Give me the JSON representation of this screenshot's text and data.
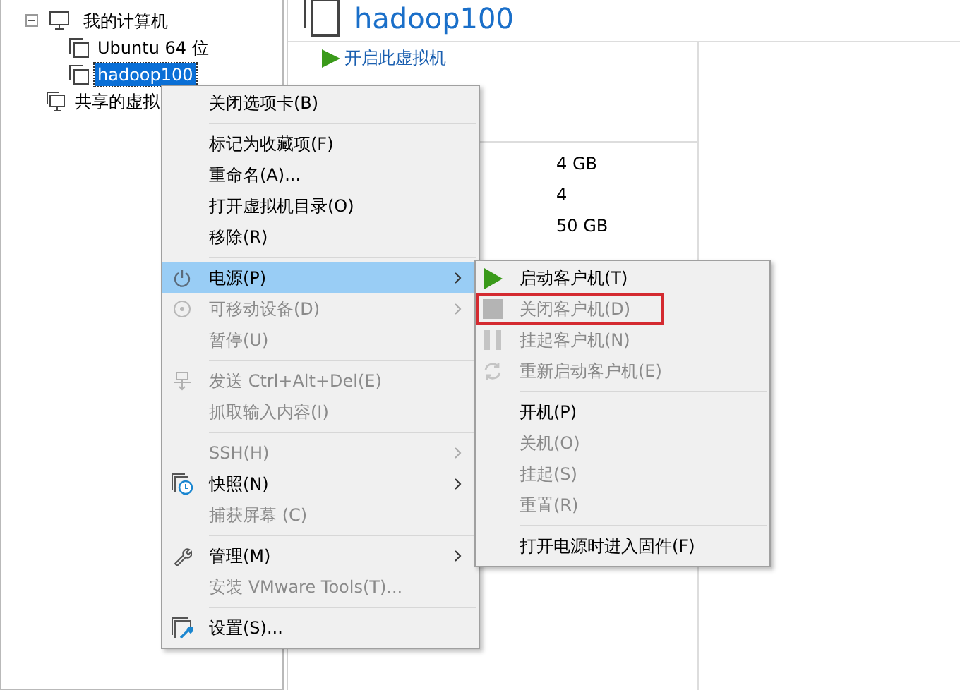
{
  "tree": [
    {
      "label": "我的计算机",
      "kind": "computer",
      "expanded": true,
      "selected": false,
      "children": [
        {
          "label": "Ubuntu 64 位",
          "kind": "vm",
          "selected": false
        },
        {
          "label": "hadoop100",
          "kind": "vm",
          "selected": true
        }
      ]
    },
    {
      "label": "共享的虚拟",
      "kind": "shared",
      "selected": false
    }
  ],
  "summary": {
    "title": "hadoop100",
    "action": "开启此虚拟机",
    "values": [
      "4 GB",
      "4",
      "50 GB"
    ]
  },
  "menu": {
    "items": [
      {
        "kind": "item",
        "label": "关闭选项卡(B)",
        "disabled": false,
        "submenu": false,
        "selected": false
      },
      {
        "kind": "separator"
      },
      {
        "kind": "item",
        "label": "标记为收藏项(F)",
        "disabled": false,
        "submenu": false,
        "selected": false
      },
      {
        "kind": "item",
        "label": "重命名(A)...",
        "disabled": false,
        "submenu": false,
        "selected": false
      },
      {
        "kind": "item",
        "label": "打开虚拟机目录(O)",
        "disabled": false,
        "submenu": false,
        "selected": false
      },
      {
        "kind": "item",
        "label": "移除(R)",
        "disabled": false,
        "submenu": false,
        "selected": false
      },
      {
        "kind": "separator"
      },
      {
        "kind": "item",
        "label": "电源(P)",
        "disabled": false,
        "submenu": true,
        "selected": true
      },
      {
        "kind": "item",
        "label": "可移动设备(D)",
        "disabled": true,
        "submenu": true,
        "selected": false
      },
      {
        "kind": "item",
        "label": "暂停(U)",
        "disabled": true,
        "submenu": false,
        "selected": false
      },
      {
        "kind": "separator"
      },
      {
        "kind": "item",
        "label": "发送 Ctrl+Alt+Del(E)",
        "disabled": true,
        "submenu": false,
        "selected": false
      },
      {
        "kind": "item",
        "label": "抓取输入内容(I)",
        "disabled": true,
        "submenu": false,
        "selected": false
      },
      {
        "kind": "separator"
      },
      {
        "kind": "item",
        "label": "SSH(H)",
        "disabled": true,
        "submenu": true,
        "selected": false
      },
      {
        "kind": "item",
        "label": "快照(N)",
        "disabled": false,
        "submenu": true,
        "selected": false
      },
      {
        "kind": "item",
        "label": "捕获屏幕 (C)",
        "disabled": true,
        "submenu": false,
        "selected": false
      },
      {
        "kind": "separator"
      },
      {
        "kind": "item",
        "label": "管理(M)",
        "disabled": false,
        "submenu": true,
        "selected": false
      },
      {
        "kind": "item",
        "label": "安装 VMware Tools(T)...",
        "disabled": true,
        "submenu": false,
        "selected": false
      },
      {
        "kind": "separator"
      },
      {
        "kind": "item",
        "label": "设置(S)...",
        "disabled": false,
        "submenu": false,
        "selected": false
      }
    ]
  },
  "submenu": {
    "items": [
      {
        "kind": "item",
        "label": "启动客户机(T)",
        "disabled": false,
        "outlined": false
      },
      {
        "kind": "item",
        "label": "关闭客户机(D)",
        "disabled": true,
        "outlined": true
      },
      {
        "kind": "item",
        "label": "挂起客户机(N)",
        "disabled": true,
        "outlined": false
      },
      {
        "kind": "item",
        "label": "重新启动客户机(E)",
        "disabled": true,
        "outlined": false
      },
      {
        "kind": "separator"
      },
      {
        "kind": "item",
        "label": "开机(P)",
        "disabled": false,
        "outlined": false
      },
      {
        "kind": "item",
        "label": "关机(O)",
        "disabled": true,
        "outlined": false
      },
      {
        "kind": "item",
        "label": "挂起(S)",
        "disabled": true,
        "outlined": false
      },
      {
        "kind": "item",
        "label": "重置(R)",
        "disabled": true,
        "outlined": false
      },
      {
        "kind": "separator"
      },
      {
        "kind": "item",
        "label": "打开电源时进入固件(F)",
        "disabled": false,
        "outlined": false
      }
    ]
  }
}
